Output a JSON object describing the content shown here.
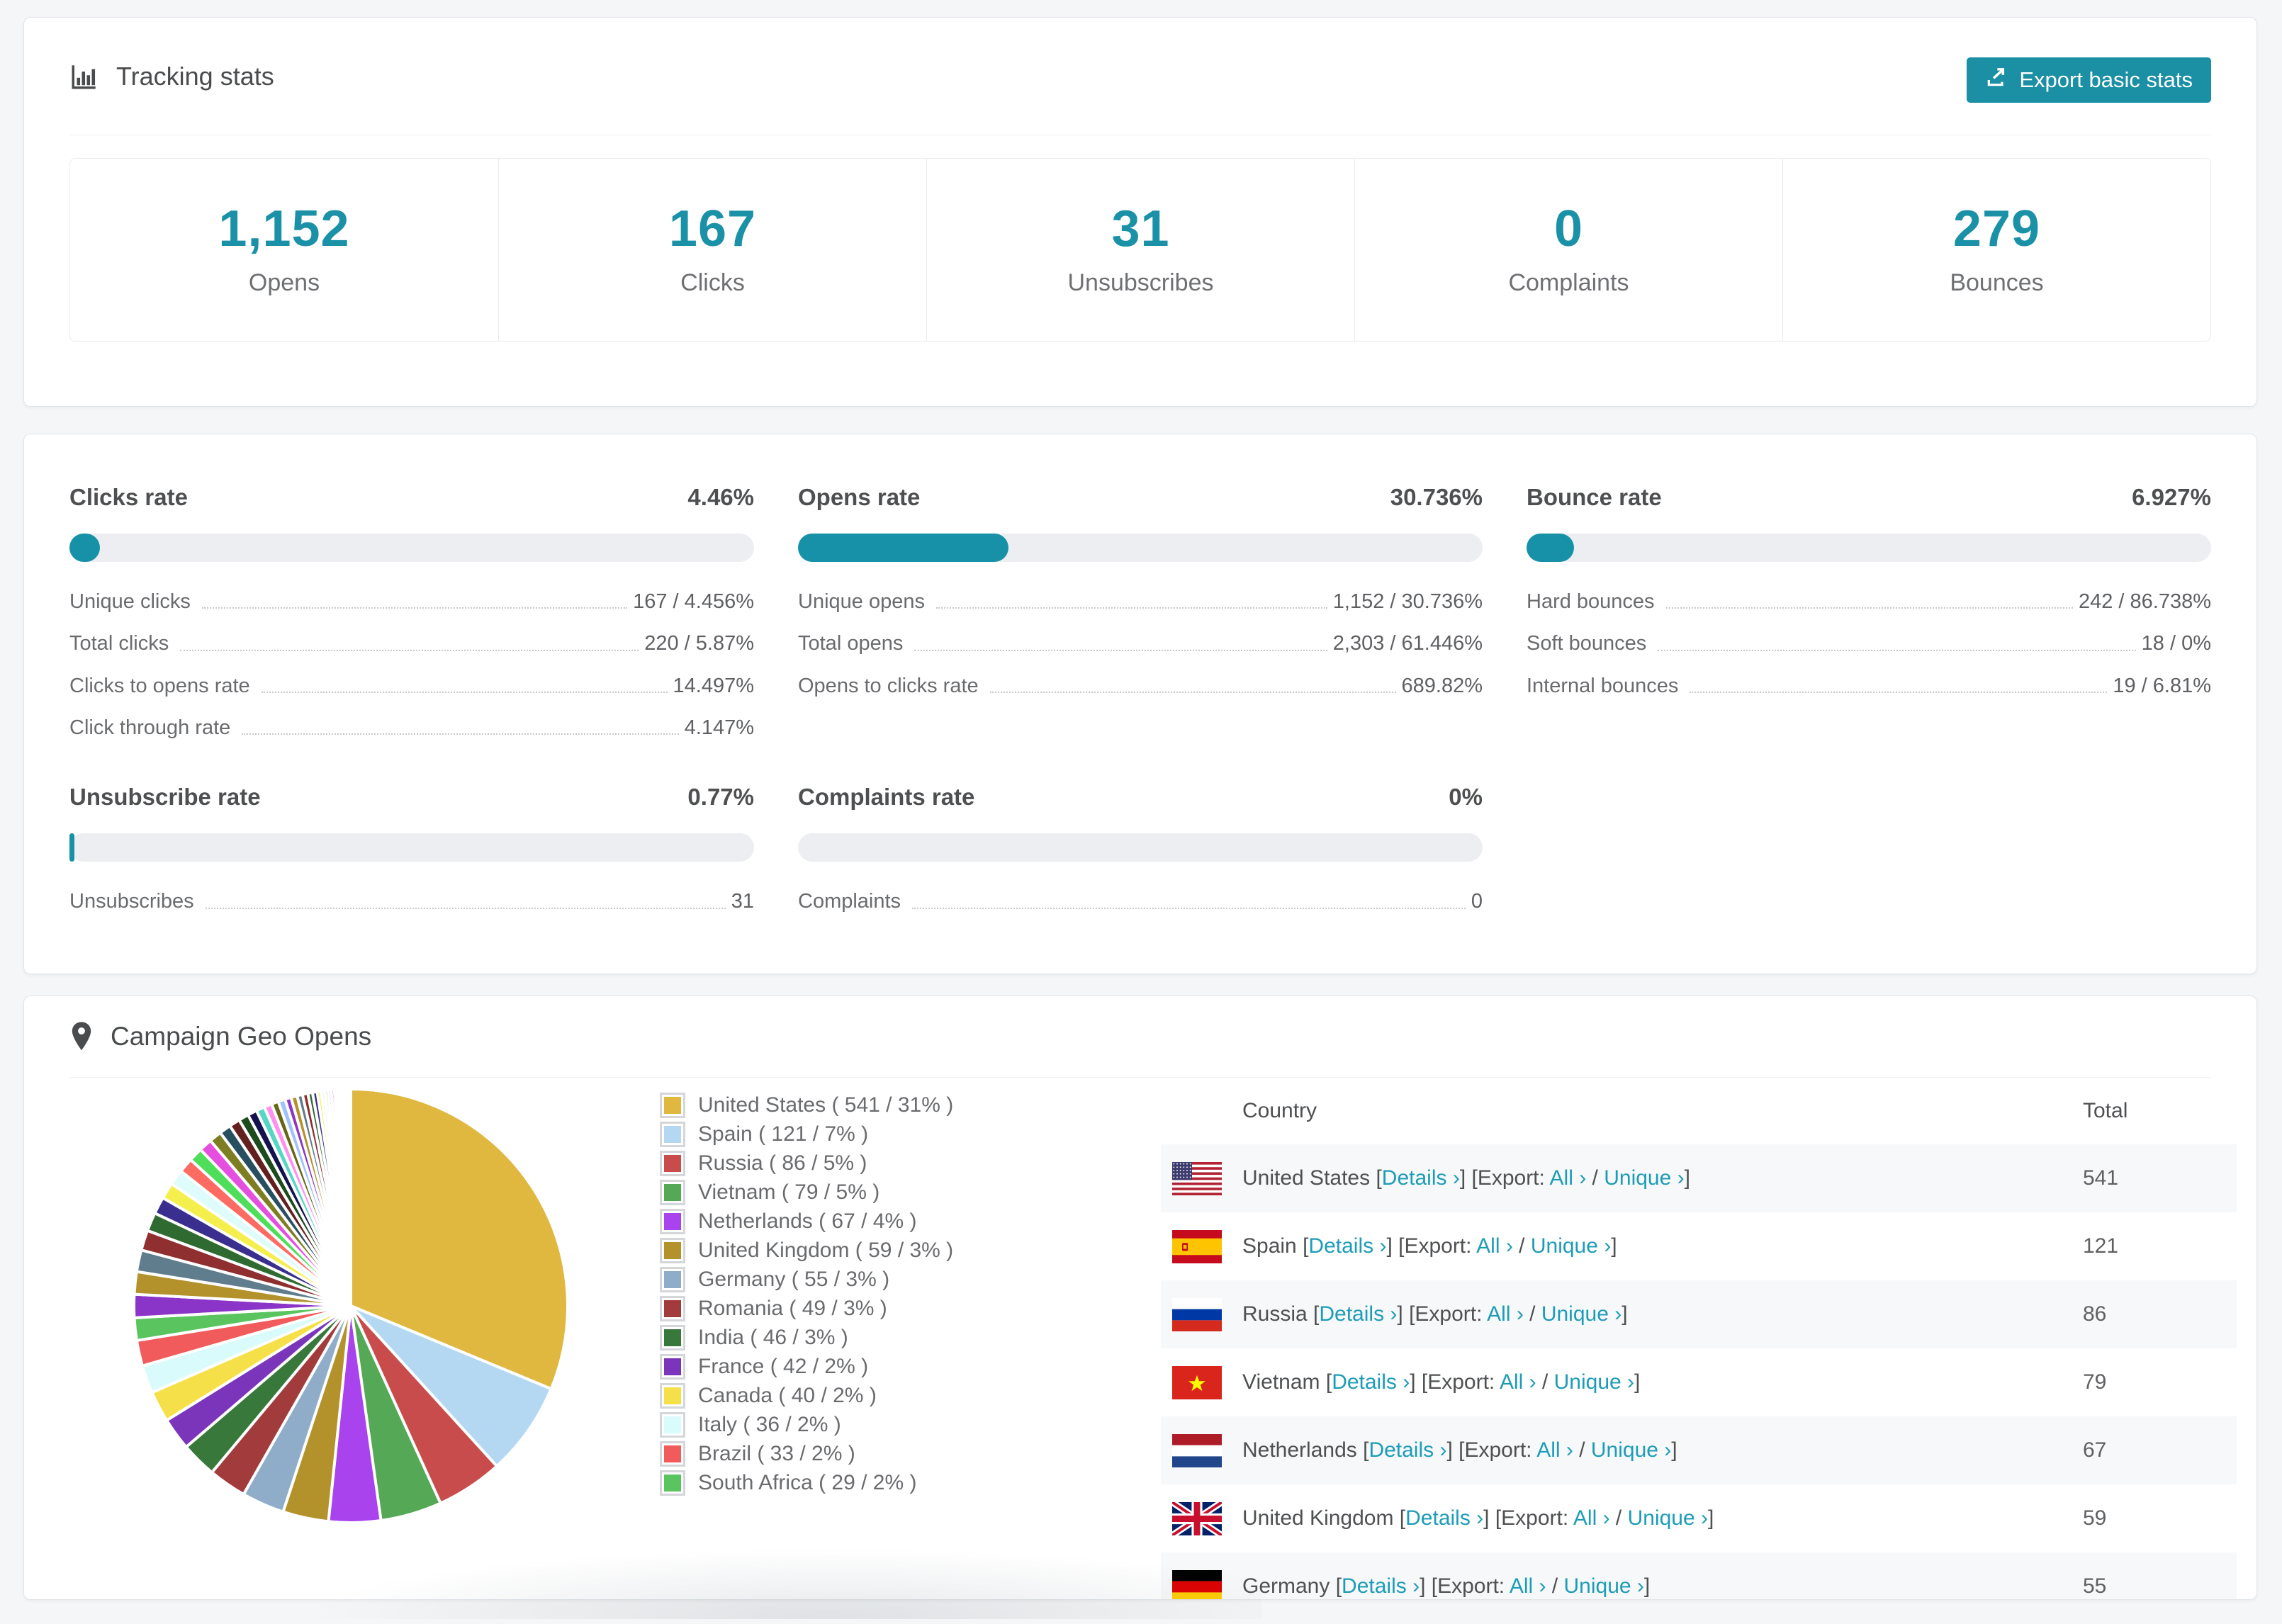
{
  "theme": {
    "accent": "#1b91a8",
    "button": "#1b8fa4",
    "link": "#1d9cb8",
    "bar_track": "#eceef1"
  },
  "tracking": {
    "title": "Tracking stats",
    "icon": "bar-chart-icon",
    "export_label": "Export basic stats",
    "stats": [
      {
        "value": "1,152",
        "label": "Opens"
      },
      {
        "value": "167",
        "label": "Clicks"
      },
      {
        "value": "31",
        "label": "Unsubscribes"
      },
      {
        "value": "0",
        "label": "Complaints"
      },
      {
        "value": "279",
        "label": "Bounces"
      }
    ]
  },
  "rates": [
    {
      "title": "Clicks rate",
      "pct": "4.46%",
      "bar_pct": 4.46,
      "rows": [
        [
          "Unique clicks",
          "167 / 4.456%"
        ],
        [
          "Total clicks",
          "220 / 5.87%"
        ],
        [
          "Clicks to opens rate",
          "14.497%"
        ],
        [
          "Click through rate",
          "4.147%"
        ]
      ]
    },
    {
      "title": "Opens rate",
      "pct": "30.736%",
      "bar_pct": 30.736,
      "rows": [
        [
          "Unique opens",
          "1,152 / 30.736%"
        ],
        [
          "Total opens",
          "2,303 / 61.446%"
        ],
        [
          "Opens to clicks rate",
          "689.82%"
        ]
      ]
    },
    {
      "title": "Bounce rate",
      "pct": "6.927%",
      "bar_pct": 6.927,
      "rows": [
        [
          "Hard bounces",
          "242 / 86.738%"
        ],
        [
          "Soft bounces",
          "18 / 0%"
        ],
        [
          "Internal bounces",
          "19 / 6.81%"
        ]
      ]
    },
    {
      "title": "Unsubscribe rate",
      "pct": "0.77%",
      "bar_pct": 0.77,
      "rows": [
        [
          "Unsubscribes",
          "31"
        ]
      ]
    },
    {
      "title": "Complaints rate",
      "pct": "0%",
      "bar_pct": 0,
      "rows": [
        [
          "Complaints",
          "0"
        ]
      ]
    }
  ],
  "geo": {
    "title": "Campaign Geo Opens",
    "icon": "map-pin-icon",
    "table_headers": {
      "country": "Country",
      "total": "Total"
    },
    "links": {
      "details": "Details ›",
      "export_prefix": "Export:",
      "all": "All ›",
      "unique": "Unique ›"
    },
    "table_rows": [
      {
        "name": "United States",
        "flag": "us",
        "total": "541"
      },
      {
        "name": "Spain",
        "flag": "es",
        "total": "121"
      },
      {
        "name": "Russia",
        "flag": "ru",
        "total": "86"
      },
      {
        "name": "Vietnam",
        "flag": "vn",
        "total": "79"
      },
      {
        "name": "Netherlands",
        "flag": "nl",
        "total": "67"
      },
      {
        "name": "United Kingdom",
        "flag": "gb",
        "total": "59"
      },
      {
        "name": "Germany",
        "flag": "de",
        "total": "55"
      }
    ],
    "chart_data": {
      "type": "pie",
      "title": "Campaign Geo Opens",
      "unit": "opens",
      "legend_position": "right",
      "start_angle_deg": 0,
      "direction": "clockwise",
      "series": [
        {
          "label": "United States",
          "value": 541,
          "pct": 31,
          "color": "#e0b73f"
        },
        {
          "label": "Spain",
          "value": 121,
          "pct": 7,
          "color": "#b5d8f2"
        },
        {
          "label": "Russia",
          "value": 86,
          "pct": 5,
          "color": "#c94c4c"
        },
        {
          "label": "Vietnam",
          "value": 79,
          "pct": 5,
          "color": "#55a855"
        },
        {
          "label": "Netherlands",
          "value": 67,
          "pct": 4,
          "color": "#a843ee"
        },
        {
          "label": "United Kingdom",
          "value": 59,
          "pct": 3,
          "color": "#b3922b"
        },
        {
          "label": "Germany",
          "value": 55,
          "pct": 3,
          "color": "#8fadc8"
        },
        {
          "label": "Romania",
          "value": 49,
          "pct": 3,
          "color": "#a23c3c"
        },
        {
          "label": "India",
          "value": 46,
          "pct": 3,
          "color": "#38783a"
        },
        {
          "label": "France",
          "value": 42,
          "pct": 2,
          "color": "#7b35ba"
        },
        {
          "label": "Canada",
          "value": 40,
          "pct": 2,
          "color": "#f6e04a"
        },
        {
          "label": "Italy",
          "value": 36,
          "pct": 2,
          "color": "#d9fbfb"
        },
        {
          "label": "Brazil",
          "value": 33,
          "pct": 2,
          "color": "#f15b5b"
        },
        {
          "label": "South Africa",
          "value": 29,
          "pct": 2,
          "color": "#5ac55f"
        }
      ],
      "others_estimated_values": [
        30,
        29,
        28,
        26,
        24,
        22,
        21,
        20,
        19,
        18,
        17,
        16,
        15,
        14,
        13,
        12,
        11,
        10,
        9,
        9,
        8,
        8,
        7,
        7,
        6,
        6,
        5,
        5,
        4,
        4,
        4,
        3,
        3,
        3,
        2,
        2,
        2,
        2,
        1,
        1,
        1,
        1
      ],
      "others_palette": [
        "#8a35c8",
        "#b3922b",
        "#5f7d8c",
        "#8f2f2f",
        "#2f6b31",
        "#3a2f8f",
        "#f5ef4e",
        "#dffcfc",
        "#fd6b63",
        "#4ede5a",
        "#e44fe0",
        "#7d7d22",
        "#274f5f",
        "#641f1f",
        "#1c4c1e",
        "#14124f",
        "#58d6c5",
        "#ff8ff0",
        "#666616",
        "#9fc2ff"
      ]
    }
  }
}
